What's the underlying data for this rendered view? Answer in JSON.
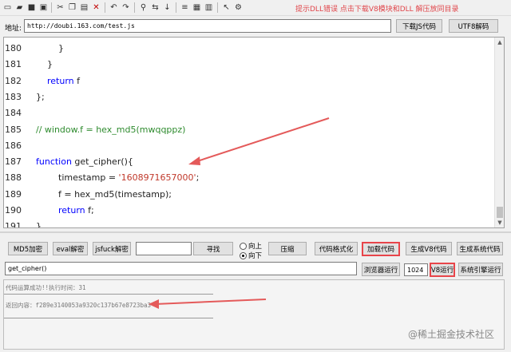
{
  "toolbar": {
    "icons": [
      "new-file-icon",
      "open-folder-icon",
      "save-icon",
      "save-all-icon",
      "cut-icon",
      "copy-icon",
      "paste-icon",
      "delete-icon",
      "undo-icon",
      "redo-icon",
      "find-icon",
      "find-replace-icon",
      "goto-icon",
      "align-icon",
      "select-all-icon",
      "help-cursor-icon",
      "tools-icon"
    ],
    "hint": "提示DLL错误  点击下载V8模块和DLL  解压放同目录"
  },
  "address": {
    "label": "地址:",
    "url": "http://doubi.163.com/test.js",
    "download_button": "下载JS代码",
    "utf8_button": "UTF8解码"
  },
  "editor": {
    "lines": [
      {
        "num": "180",
        "indent": 2,
        "parts": [
          {
            "t": "}",
            "c": ""
          }
        ]
      },
      {
        "num": "181",
        "indent": 1,
        "parts": [
          {
            "t": "}",
            "c": ""
          }
        ]
      },
      {
        "num": "182",
        "indent": 1,
        "parts": [
          {
            "t": "return",
            "c": "kw"
          },
          {
            "t": " f",
            "c": ""
          }
        ]
      },
      {
        "num": "183",
        "indent": 0,
        "parts": [
          {
            "t": "};",
            "c": ""
          }
        ]
      },
      {
        "num": "184",
        "indent": 0,
        "parts": []
      },
      {
        "num": "185",
        "indent": 0,
        "parts": [
          {
            "t": "// window.f = hex_md5(mwqqppz)",
            "c": "cmt"
          }
        ]
      },
      {
        "num": "186",
        "indent": 0,
        "parts": []
      },
      {
        "num": "187",
        "indent": 0,
        "parts": [
          {
            "t": "function",
            "c": "kw"
          },
          {
            "t": " get_cipher(){",
            "c": ""
          }
        ]
      },
      {
        "num": "188",
        "indent": 2,
        "parts": [
          {
            "t": "timestamp = ",
            "c": ""
          },
          {
            "t": "'1608971657000'",
            "c": "str"
          },
          {
            "t": ";",
            "c": ""
          }
        ]
      },
      {
        "num": "189",
        "indent": 2,
        "parts": [
          {
            "t": "f = hex_md5(timestamp);",
            "c": ""
          }
        ]
      },
      {
        "num": "190",
        "indent": 2,
        "parts": [
          {
            "t": "return",
            "c": "kw"
          },
          {
            "t": " f;",
            "c": ""
          }
        ]
      },
      {
        "num": "191",
        "indent": 0,
        "parts": [
          {
            "t": "}",
            "c": ""
          }
        ]
      }
    ]
  },
  "controls": {
    "md5_button": "MD5加密",
    "eval_button": "eval解密",
    "jsfuck_button": "jsfuck解密",
    "search_value": "",
    "search_button": "寻找",
    "radio_up": "向上",
    "radio_down": "向下",
    "radio_selected": "down",
    "compress_button": "压缩",
    "format_button": "代码格式化",
    "load_button": "加载代码",
    "gen_v8_button": "生成V8代码",
    "gen_sys_button": "生成系统代码",
    "call_input": "get_cipher()",
    "browser_run_button": "浏览器运行",
    "number_value": "1024",
    "v8_run_button": "V8运行",
    "sys_engine_button": "系统引擎运行"
  },
  "output": {
    "line1": "代码运算成功!!执行时间：31",
    "line2_label": "返回内容：",
    "line2_value": "f289e3140053a9320c137b67e8723ba3"
  },
  "watermark": "@稀土掘金技术社区",
  "colors": {
    "highlight": "#e8454a",
    "keyword": "#0000ff",
    "string": "#c0392b",
    "comment": "#2e8b2e"
  }
}
